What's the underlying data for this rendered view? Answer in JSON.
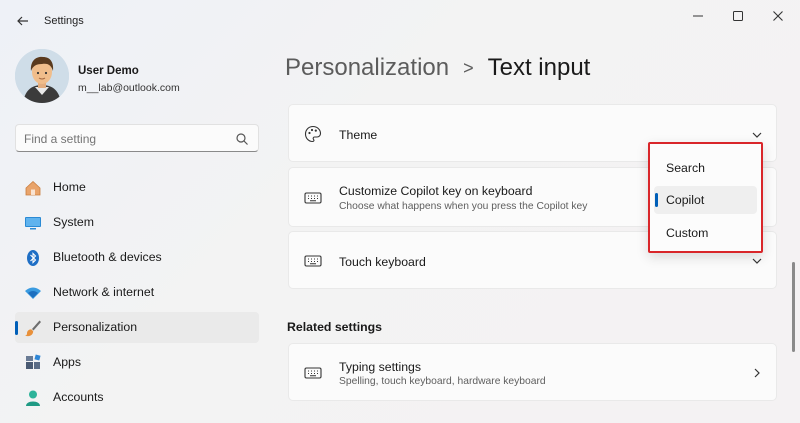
{
  "window": {
    "title": "Settings"
  },
  "profile": {
    "name": "User Demo",
    "email": "m__lab@outlook.com"
  },
  "search": {
    "placeholder": "Find a setting"
  },
  "sidebar": {
    "items": [
      {
        "label": "Home",
        "icon": "home-icon"
      },
      {
        "label": "System",
        "icon": "system-icon"
      },
      {
        "label": "Bluetooth & devices",
        "icon": "bluetooth-icon"
      },
      {
        "label": "Network & internet",
        "icon": "network-icon"
      },
      {
        "label": "Personalization",
        "icon": "brush-icon",
        "active": true
      },
      {
        "label": "Apps",
        "icon": "apps-icon"
      },
      {
        "label": "Accounts",
        "icon": "accounts-icon"
      }
    ]
  },
  "breadcrumb": {
    "parent": "Personalization",
    "separator": ">",
    "current": "Text input"
  },
  "cards": {
    "theme": {
      "title": "Theme",
      "icon": "palette-icon"
    },
    "copilot_key": {
      "title": "Customize Copilot key on keyboard",
      "subtitle": "Choose what happens when you press the Copilot key",
      "icon": "keyboard-icon"
    },
    "touch_keyboard": {
      "title": "Touch keyboard",
      "icon": "keyboard-icon"
    }
  },
  "related": {
    "title": "Related settings",
    "typing": {
      "title": "Typing settings",
      "subtitle": "Spelling, touch keyboard, hardware keyboard",
      "icon": "keyboard-icon"
    }
  },
  "flyout": {
    "options": [
      "Search",
      "Copilot",
      "Custom"
    ],
    "selected": "Copilot"
  },
  "colors": {
    "accent": "#005fb8",
    "highlight_border": "#d9262a"
  }
}
